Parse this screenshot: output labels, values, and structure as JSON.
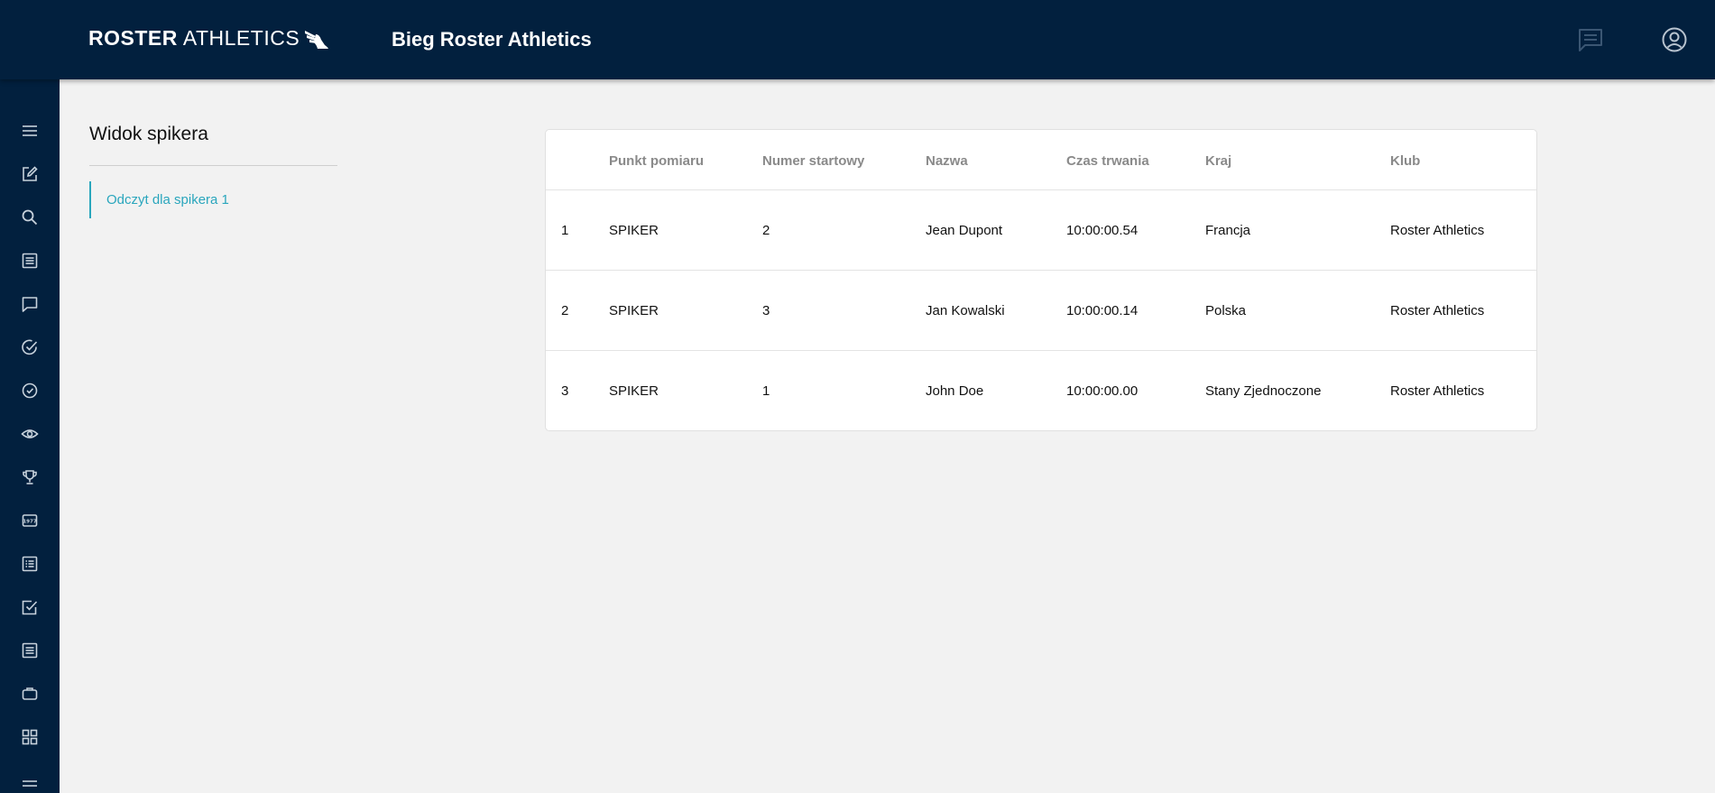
{
  "header": {
    "logo_bold": "ROSTER",
    "logo_light": "ATHLETICS",
    "event_title": "Bieg Roster Athletics"
  },
  "colors": {
    "navy": "#02203e",
    "accent": "#2aa6bd",
    "background": "#f2f2f2"
  },
  "icons": {
    "top": [
      "chat-icon",
      "account-icon"
    ],
    "sidebar": [
      "menu-icon",
      "edit-icon",
      "search-icon",
      "list-icon",
      "message-icon",
      "check-circle-icon",
      "check-circle-small-icon",
      "eye-icon",
      "trophy-icon",
      "bib-icon",
      "results-list-icon",
      "checkbox-icon",
      "document-list-icon",
      "briefcase-icon",
      "grid-icon",
      "collapse-icon"
    ]
  },
  "panel": {
    "title": "Widok spikera",
    "link": "Odczyt dla spikera 1"
  },
  "table": {
    "columns": [
      "",
      "Punkt pomiaru",
      "Numer startowy",
      "Nazwa",
      "Czas trwania",
      "Kraj",
      "Klub"
    ],
    "rows": [
      [
        "1",
        "SPIKER",
        "2",
        "Jean Dupont",
        "10:00:00.54",
        "Francja",
        "Roster Athletics"
      ],
      [
        "2",
        "SPIKER",
        "3",
        "Jan Kowalski",
        "10:00:00.14",
        "Polska",
        "Roster Athletics"
      ],
      [
        "3",
        "SPIKER",
        "1",
        "John Doe",
        "10:00:00.00",
        "Stany Zjednoczone",
        "Roster Athletics"
      ]
    ]
  }
}
